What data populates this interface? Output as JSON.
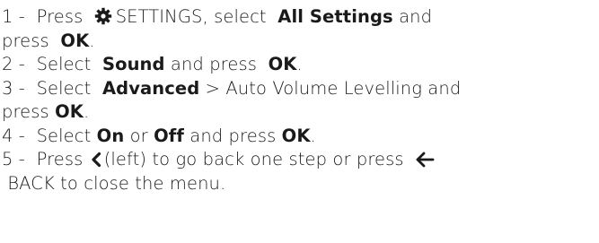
{
  "steps": [
    {
      "num": "1 -",
      "press": "Press",
      "icon": "gear-icon",
      "settings": "SETTINGS, select",
      "all_settings": "All Settings",
      "and_press": "and",
      "line2_press": "press",
      "ok": "OK",
      "dot": "."
    },
    {
      "num": "2 -",
      "select": "Select",
      "sound": "Sound",
      "and_press": "and press",
      "ok": "OK",
      "dot": "."
    },
    {
      "num": "3 -",
      "select": "Select",
      "advanced": "Advanced",
      "rest": "> Auto Volume Levelling and",
      "line2_press": "press",
      "ok": "OK",
      "dot": "."
    },
    {
      "num": "4 -",
      "select": "Select",
      "on": "On",
      "or": "or",
      "off": "Off",
      "and_press": "and press",
      "ok": "OK",
      "dot": "."
    },
    {
      "num": "5 -",
      "press": "Press",
      "left_icon": "chevron-left-icon",
      "left_text": "(left) to go back one step or press",
      "back_icon": "arrow-left-icon",
      "back_text": "BACK to close the menu."
    }
  ]
}
